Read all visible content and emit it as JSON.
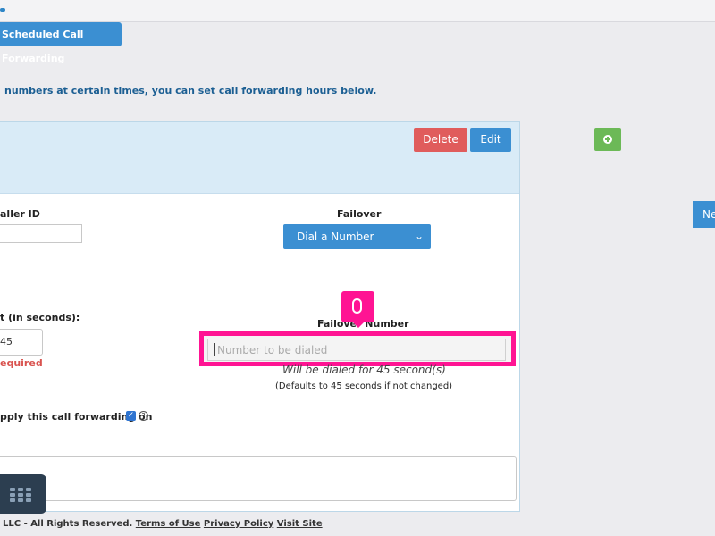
{
  "header": {
    "scheduled_button_label": "Scheduled Call Forwarding"
  },
  "intro_text": "numbers at certain times, you can set call forwarding hours below.",
  "panel": {
    "delete_label": "Delete",
    "edit_label": "Edit"
  },
  "side": {
    "add_icon": "plus-circle-icon",
    "next_label": "Ne"
  },
  "form": {
    "caller_id_label": "aller ID",
    "caller_id_value": "",
    "failover_label": "Failover",
    "failover_selected": "Dial a Number",
    "timeout_label": "t (in seconds):",
    "timeout_value": "45",
    "required_text": "equired",
    "failover_number_label": "Failover Number",
    "failover_number_placeholder": "Number to be dialed",
    "dialed_note": "Will be dialed for 45 second(s)",
    "defaults_note": "(Defaults to 45 seconds if not changed)",
    "apply_label": "pply this call forwarding on",
    "apply_checked": true
  },
  "footer": {
    "copyright": "LLC - All Rights Reserved.",
    "terms_label": "Terms of Use",
    "privacy_label": "Privacy Policy",
    "visit_label": "Visit Site"
  },
  "colors": {
    "primary": "#3b8fd2",
    "danger": "#e05c5c",
    "success": "#6cb957",
    "highlight": "#ff1493"
  }
}
